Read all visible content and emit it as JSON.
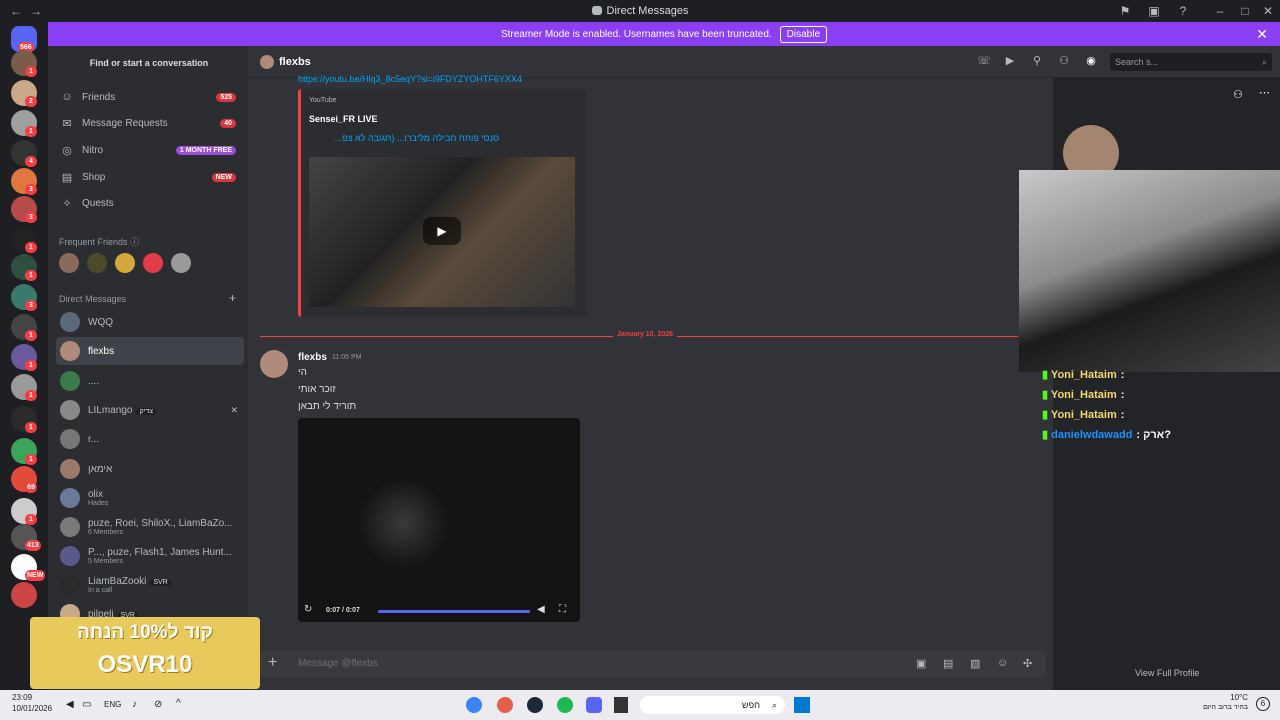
{
  "window": {
    "title": "Direct Messages"
  },
  "banner": {
    "text": "Streamer Mode is enabled. Usernames have been truncated.",
    "button": "Disable"
  },
  "servers": {
    "badges": [
      "566",
      "1",
      "2",
      "1",
      "4",
      "3",
      "3",
      "1",
      "1",
      "3",
      "1",
      "1",
      "1",
      "1",
      "1",
      "69",
      "1",
      "413",
      "NEW"
    ]
  },
  "sidebar": {
    "search_label": "Find or start a conversation",
    "nav": [
      {
        "label": "Friends",
        "tag": "525"
      },
      {
        "label": "Message Requests",
        "tag": "40"
      },
      {
        "label": "Nitro",
        "tag": "1 MONTH FREE"
      },
      {
        "label": "Shop",
        "tag": "NEW"
      },
      {
        "label": "Quests",
        "tag": ""
      }
    ],
    "frequent_friends": "Frequent Friends",
    "direct_messages": "Direct Messages",
    "dms": [
      {
        "name": "WQQ",
        "sub": ""
      },
      {
        "name": "flexbs",
        "sub": ""
      },
      {
        "name": "....",
        "sub": ""
      },
      {
        "name": "LILmango",
        "sub": ""
      },
      {
        "name": "r...",
        "sub": ""
      },
      {
        "name": "אימאן",
        "sub": ""
      },
      {
        "name": "olix",
        "sub": "Hades"
      },
      {
        "name": "puze, Roei, ShiloX., LiamBaZo...",
        "sub": "6 Members"
      },
      {
        "name": "P..., puze, Flash1, James Hunt...",
        "sub": "5 Members"
      },
      {
        "name": "LiamBaZooki",
        "sub": "In a call"
      },
      {
        "name": "pilpeli",
        "sub": ""
      }
    ],
    "dm_tags": {
      "lilmango": "צדיק",
      "liambazooki": "SVR",
      "pilpeli": "SVR"
    }
  },
  "chat": {
    "channel": "flexbs",
    "link": "https://youtu.be/Hlq3_8c5eqY?si=i9FDYZYOHTF6YXX4",
    "embed": {
      "provider": "YouTube",
      "author": "Sensei_FR LIVE",
      "title": "סנסי פותח חבילה מליברו... (תגובה לא צפ..."
    },
    "date_divider": "January 10, 2026",
    "message": {
      "author": "flexbs",
      "time": "11:05 PM",
      "lines": [
        "הי",
        "זוכר אותי",
        "תוריד לי תבאן"
      ]
    },
    "video": {
      "time": "0:07 / 0:07",
      "progress": 1.0
    },
    "compose_placeholder": "Message @flexbs",
    "search_placeholder": "Search s..."
  },
  "overlay": {
    "chat_lines": [
      {
        "user": "Yoni_Hataim",
        "text": ":"
      },
      {
        "user": "Yoni_Hataim",
        "text": ":"
      },
      {
        "user": "Yoni_Hataim",
        "text": ":"
      },
      {
        "user": "danielwdawadd",
        "text": ": ארק?"
      }
    ],
    "view_profile": "View Full Profile",
    "promo": [
      "קוד ל10% הנחה",
      "OSVR10"
    ]
  },
  "taskbar": {
    "time": "23:09",
    "date": "10/01/2026",
    "lang": "ENG",
    "search": "חפש",
    "weather_temp": "10°C",
    "weather_text": "בהיר ברוב היום",
    "notify": "6"
  }
}
